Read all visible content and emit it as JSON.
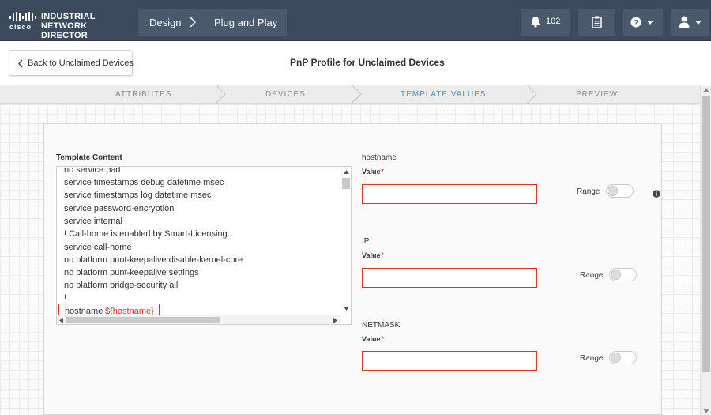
{
  "header": {
    "logo_word": "cisco",
    "app_title": "INDUSTRIAL NETWORK DIRECTOR",
    "breadcrumb": [
      "Design",
      "Plug and Play"
    ],
    "notification_count": "102"
  },
  "subheader": {
    "back_label": "Back to Unclaimed Devices",
    "title": "PnP Profile for Unclaimed Devices"
  },
  "steps": [
    {
      "label": "ATTRIBUTES",
      "active": false
    },
    {
      "label": "DEVICES",
      "active": false
    },
    {
      "label": "TEMPLATE VALUES",
      "active": true
    },
    {
      "label": "PREVIEW",
      "active": false
    }
  ],
  "template": {
    "label": "Template Content",
    "lines": [
      "no service pad",
      "service timestamps debug datetime msec",
      "service timestamps log datetime msec",
      "service password-encryption",
      "service internal",
      "! Call-home is enabled by Smart-Licensing.",
      "service call-home",
      "no platform punt-keepalive disable-kernel-core",
      "no platform punt-keepalive settings",
      "no platform bridge-security all",
      "!"
    ],
    "highlight_key": "hostname",
    "highlight_var": "${hostname}"
  },
  "fields": [
    {
      "name": "hostname",
      "sub_label": "Value",
      "required_mark": "*",
      "value": "",
      "range_label": "Range",
      "range_on": false
    },
    {
      "name": "IP",
      "sub_label": "Value",
      "required_mark": "*",
      "value": "",
      "range_label": "Range",
      "range_on": false
    },
    {
      "name": "NETMASK",
      "sub_label": "Value",
      "required_mark": "*",
      "value": "",
      "range_label": "Range",
      "range_on": false
    }
  ],
  "colors": {
    "header_bg": "#3b4b5d",
    "active_step": "#4c8fbd",
    "error_red": "#d9342b"
  },
  "icons": [
    "cisco-logo-icon",
    "chevron-right-icon",
    "bell-icon",
    "clipboard-icon",
    "help-icon",
    "user-icon",
    "chevron-down-icon",
    "chevron-left-icon",
    "info-icon"
  ]
}
